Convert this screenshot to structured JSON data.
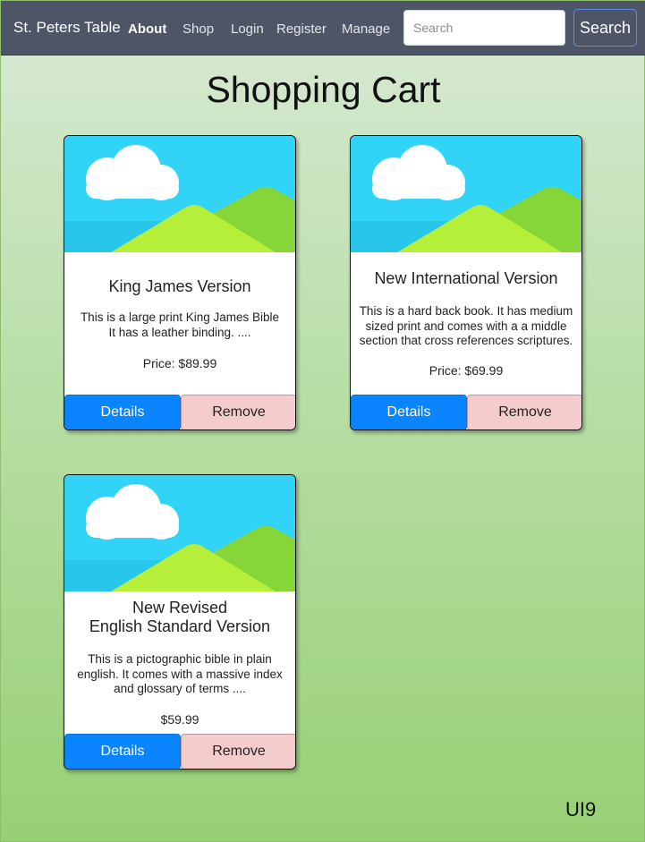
{
  "navbar": {
    "brand": "St. Peters Table",
    "links": [
      {
        "label": "About"
      },
      {
        "label": "Shop"
      },
      {
        "label": "Login"
      },
      {
        "label": "Register"
      },
      {
        "label": "Manage"
      }
    ],
    "search_placeholder": "Search",
    "search_button_label": "Search"
  },
  "page": {
    "title": "Shopping Cart",
    "footer_label": "UI9"
  },
  "cart_items": [
    {
      "title": "King James Version",
      "description": [
        "This is a large print King James Bible",
        "It has a leather binding. ...."
      ],
      "price": "Price: $89.99",
      "details_label": "Details",
      "remove_label": "Remove",
      "image_icon": "landscape-placeholder-icon"
    },
    {
      "title": "New International Version",
      "description": [
        "This is a hard back book.  It has medium",
        "sized print and comes with a a middle",
        "section that cross references scriptures."
      ],
      "price": "Price: $69.99",
      "details_label": "Details",
      "remove_label": "Remove",
      "image_icon": "landscape-placeholder-icon"
    },
    {
      "title_lines": [
        "New Revised",
        "English Standard Version"
      ],
      "description": [
        "This is a pictographic bible in plain",
        "english.  It comes with a massive index",
        "and glossary of terms ...."
      ],
      "price": "$59.99",
      "details_label": "Details",
      "remove_label": "Remove",
      "image_icon": "landscape-placeholder-icon"
    }
  ],
  "colors": {
    "navbar": "#4d5566",
    "details_button": "#0b84ff",
    "remove_button": "#f4cccc",
    "sky": "#31d4f6",
    "hill_light": "#b5ef3a",
    "hill_dark": "#86d63a"
  }
}
